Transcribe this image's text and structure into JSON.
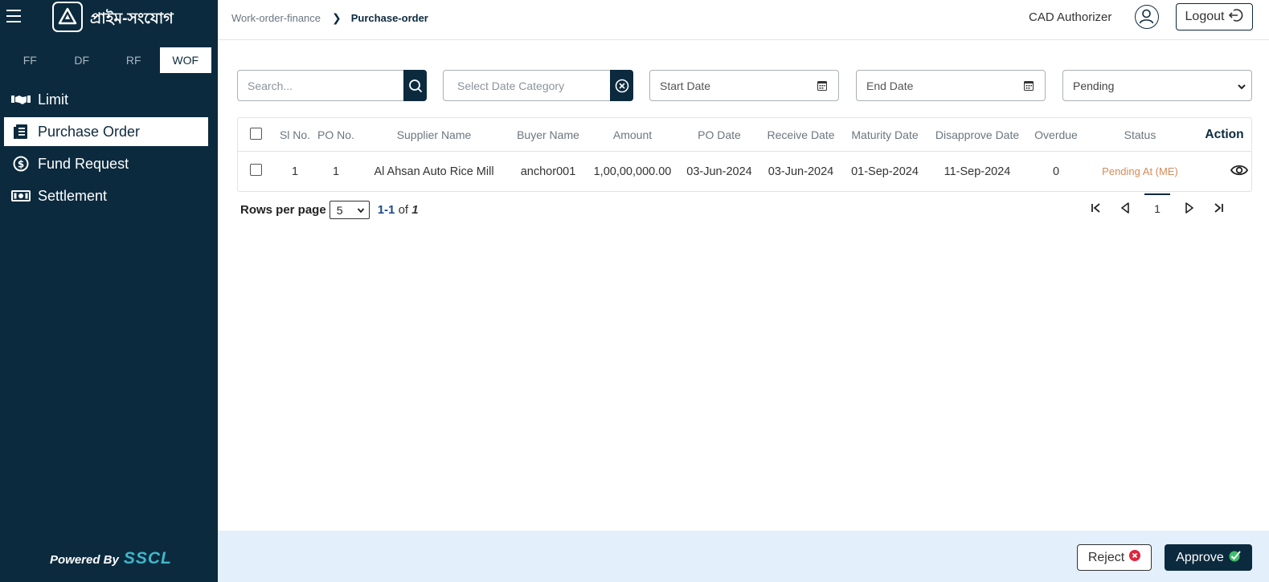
{
  "app": {
    "logo_text": "প্রাইম-সংযোগ"
  },
  "program_tabs": [
    {
      "label": "FF",
      "active": false
    },
    {
      "label": "DF",
      "active": false
    },
    {
      "label": "RF",
      "active": false
    },
    {
      "label": "WOF",
      "active": true
    }
  ],
  "nav": [
    {
      "label": "Limit",
      "icon": "handshake-icon",
      "active": false
    },
    {
      "label": "Purchase Order",
      "icon": "document-icon",
      "active": true
    },
    {
      "label": "Fund Request",
      "icon": "dollar-coin-icon",
      "active": false
    },
    {
      "label": "Settlement",
      "icon": "cash-icon",
      "active": false
    }
  ],
  "footer_brand": {
    "powered_by": "Powered By",
    "brand": "SSCL"
  },
  "breadcrumb": {
    "parent": "Work-order-finance",
    "current": "Purchase-order"
  },
  "header": {
    "user_name": "CAD Authorizer",
    "logout_label": "Logout"
  },
  "filters": {
    "search_placeholder": "Search...",
    "date_category_placeholder": "Select Date Category",
    "start_date_placeholder": "Start Date",
    "end_date_placeholder": "End Date",
    "status_value": "Pending"
  },
  "table": {
    "columns": [
      "Sl No.",
      "PO No.",
      "Supplier Name",
      "Buyer Name",
      "Amount",
      "PO Date",
      "Receive Date",
      "Maturity Date",
      "Disapprove Date",
      "Overdue",
      "Status",
      "Action"
    ],
    "rows": [
      {
        "sl_no": "1",
        "po_no": "1",
        "supplier_name": "Al Ahsan Auto Rice Mill",
        "buyer_name": "anchor001",
        "amount": "1,00,00,000.00",
        "po_date": "03-Jun-2024",
        "receive_date": "03-Jun-2024",
        "maturity_date": "01-Sep-2024",
        "disapprove_date": "11-Sep-2024",
        "overdue": "0",
        "status": "Pending At (ME)"
      }
    ]
  },
  "pagination": {
    "rows_per_page_label": "Rows per page",
    "rows_per_page_value": "5",
    "range": "1-1",
    "of_label": "of",
    "total": "1",
    "current_page": "1"
  },
  "actions": {
    "reject_label": "Reject",
    "approve_label": "Approve"
  },
  "colors": {
    "sidebar": "#0c2a3e",
    "footer_bar": "#e3effb",
    "pending_status": "#d48b57",
    "reject_icon": "#e0243c",
    "approve_icon": "#3fbf6a"
  }
}
